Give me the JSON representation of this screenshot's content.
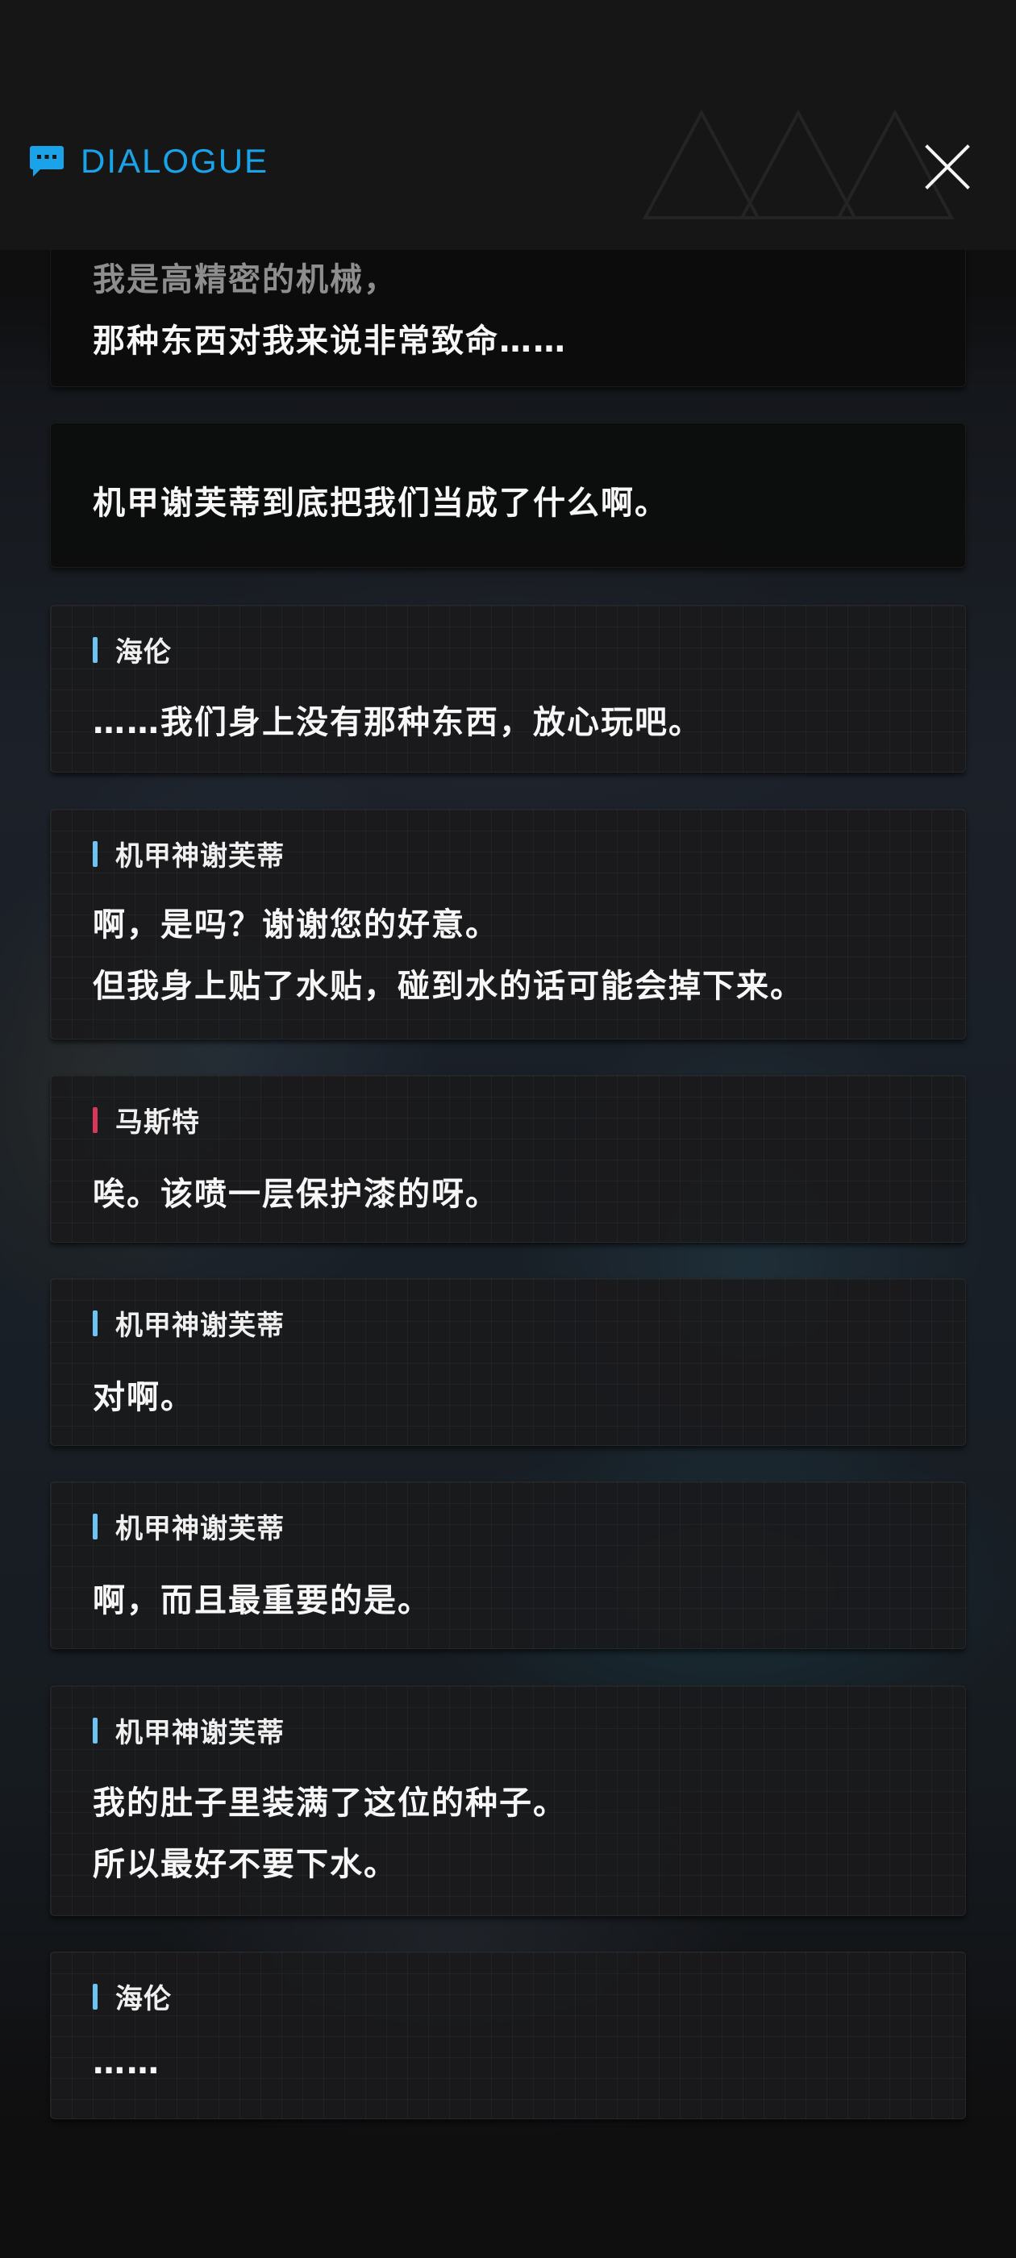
{
  "header": {
    "title": "DIALOGUE",
    "title_icon": "chat-bubble-icon",
    "close_icon": "close-icon",
    "accent_color": "#1aa3e8"
  },
  "entries": [
    {
      "speaker": "",
      "lines": [
        "我是高精密的机械，",
        "那种东西对我来说非常致命……"
      ]
    },
    {
      "speaker": "",
      "lines": [
        "机甲谢芙蒂到底把我们当成了什么啊。"
      ]
    },
    {
      "speaker": "海伦",
      "bar_color": "#6ec3f5",
      "lines": [
        "……我们身上没有那种东西，放心玩吧。"
      ]
    },
    {
      "speaker": "机甲神谢芙蒂",
      "bar_color": "#6ec3f5",
      "lines": [
        "啊，是吗？谢谢您的好意。",
        "但我身上贴了水贴，碰到水的话可能会掉下来。"
      ]
    },
    {
      "speaker": "马斯特",
      "bar_color": "#d8375a",
      "lines": [
        "唉。该喷一层保护漆的呀。"
      ]
    },
    {
      "speaker": "机甲神谢芙蒂",
      "bar_color": "#6ec3f5",
      "lines": [
        "对啊。"
      ]
    },
    {
      "speaker": "机甲神谢芙蒂",
      "bar_color": "#6ec3f5",
      "lines": [
        "啊，而且最重要的是。"
      ]
    },
    {
      "speaker": "机甲神谢芙蒂",
      "bar_color": "#6ec3f5",
      "lines": [
        "我的肚子里装满了这位的种子。",
        "所以最好不要下水。"
      ]
    },
    {
      "speaker": "海伦",
      "bar_color": "#6ec3f5",
      "lines": [
        "……"
      ]
    }
  ]
}
